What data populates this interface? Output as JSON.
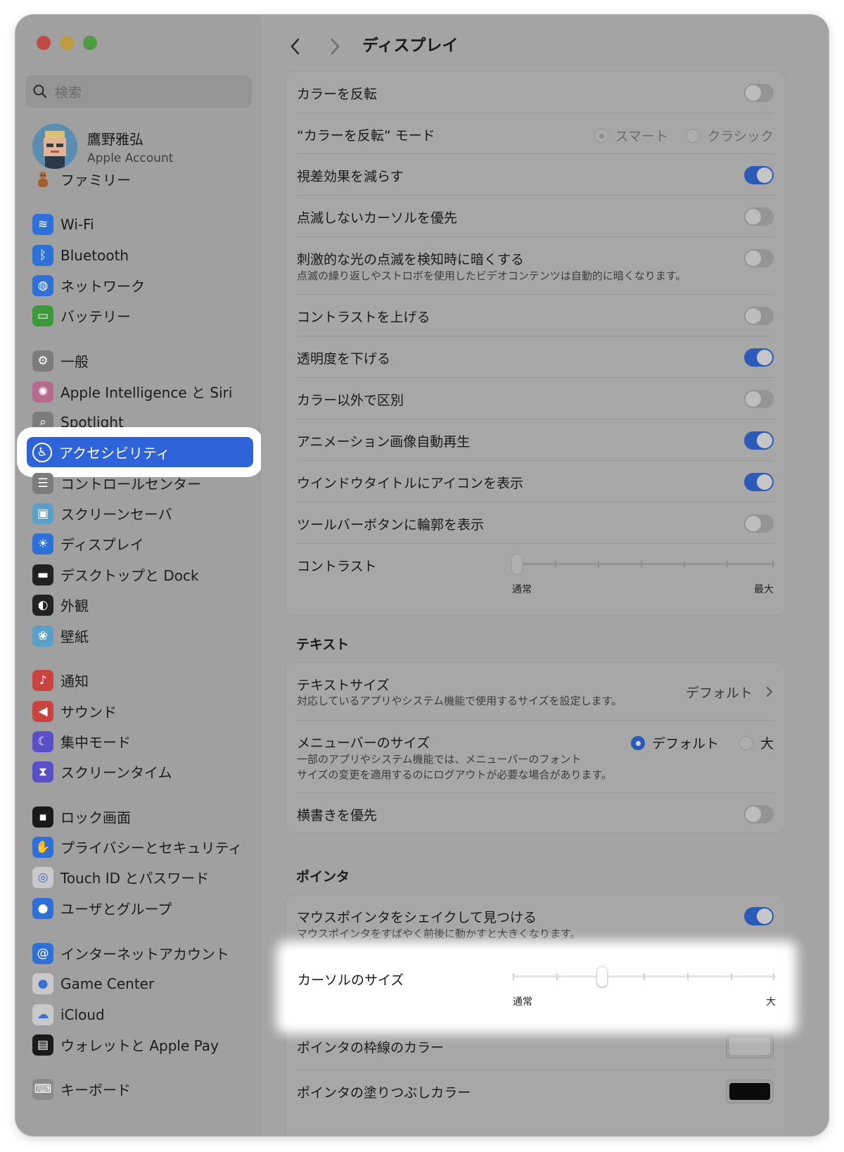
{
  "search": {
    "placeholder": "検索"
  },
  "account": {
    "name": "鷹野雅弘",
    "subtitle": "Apple Account"
  },
  "sidebar": {
    "family": "ファミリー",
    "items": [
      {
        "label": "Wi-Fi",
        "icon": "wifi-icon",
        "color": "#2f6fd8"
      },
      {
        "label": "Bluetooth",
        "icon": "bluetooth-icon",
        "color": "#2f6fd8"
      },
      {
        "label": "ネットワーク",
        "icon": "globe-icon",
        "color": "#2f6fd8"
      },
      {
        "label": "バッテリー",
        "icon": "battery-icon",
        "color": "#3c9a3a"
      },
      {
        "label": "一般",
        "icon": "gear-icon",
        "color": "#7c7c7c"
      },
      {
        "label": "Apple Intelligence と Siri",
        "icon": "siri-icon",
        "color": "#b56a8e"
      },
      {
        "label": "Spotlight",
        "icon": "spotlight-icon",
        "color": "#7c7c7c"
      },
      {
        "label": "アクセシビリティ",
        "icon": "accessibility-icon",
        "color": "#2f6fd8"
      },
      {
        "label": "コントロールセンター",
        "icon": "control-center-icon",
        "color": "#7c7c7c"
      },
      {
        "label": "スクリーンセーバ",
        "icon": "screensaver-icon",
        "color": "#5aa0c8"
      },
      {
        "label": "ディスプレイ",
        "icon": "display-icon",
        "color": "#2f6fd8"
      },
      {
        "label": "デスクトップと Dock",
        "icon": "dock-icon",
        "color": "#222222"
      },
      {
        "label": "外観",
        "icon": "appearance-icon",
        "color": "#222222"
      },
      {
        "label": "壁紙",
        "icon": "wallpaper-icon",
        "color": "#5aa0c8"
      },
      {
        "label": "通知",
        "icon": "bell-icon",
        "color": "#c9443f"
      },
      {
        "label": "サウンド",
        "icon": "speaker-icon",
        "color": "#c9443f"
      },
      {
        "label": "集中モード",
        "icon": "moon-icon",
        "color": "#5a4fc8"
      },
      {
        "label": "スクリーンタイム",
        "icon": "hourglass-icon",
        "color": "#5a4fc8"
      },
      {
        "label": "ロック画面",
        "icon": "lock-icon",
        "color": "#1a1a1a"
      },
      {
        "label": "プライバシーとセキュリティ",
        "icon": "hand-icon",
        "color": "#2f6fd8"
      },
      {
        "label": "Touch ID とパスワード",
        "icon": "fingerprint-icon",
        "color": "#c9c9c9"
      },
      {
        "label": "ユーザとグループ",
        "icon": "users-icon",
        "color": "#2f6fd8"
      },
      {
        "label": "インターネットアカウント",
        "icon": "at-icon",
        "color": "#2f6fd8"
      },
      {
        "label": "Game Center",
        "icon": "game-center-icon",
        "color": "#c9c9c9"
      },
      {
        "label": "iCloud",
        "icon": "cloud-icon",
        "color": "#c9c9c9"
      },
      {
        "label": "ウォレットと Apple Pay",
        "icon": "wallet-icon",
        "color": "#1a1a1a"
      },
      {
        "label": "キーボード",
        "icon": "keyboard-icon",
        "color": "#8a8a8a"
      }
    ],
    "selected": "アクセシビリティ"
  },
  "header": {
    "title": "ディスプレイ"
  },
  "display_settings": {
    "invert_colors": {
      "label": "カラーを反転",
      "on": false
    },
    "invert_mode": {
      "label": "“カラーを反転” モード",
      "options": [
        "スマート",
        "クラシック"
      ],
      "selected": "スマート"
    },
    "reduce_motion": {
      "label": "視差効果を減らす",
      "on": true
    },
    "non_blink_cursor": {
      "label": "点滅しないカーソルを優先",
      "on": false
    },
    "dim_flashing": {
      "label": "刺激的な光の点滅を検知時に暗くする",
      "desc": "点滅の繰り返しやストロボを使用したビデオコンテンツは自動的に暗くなります。",
      "on": false
    },
    "increase_contrast": {
      "label": "コントラストを上げる",
      "on": false
    },
    "reduce_transparency": {
      "label": "透明度を下げる",
      "on": true
    },
    "differentiate": {
      "label": "カラー以外で区別",
      "on": false
    },
    "animated_images": {
      "label": "アニメーション画像自動再生",
      "on": true
    },
    "window_title_icons": {
      "label": "ウインドウタイトルにアイコンを表示",
      "on": true
    },
    "toolbar_shapes": {
      "label": "ツールバーボタンに輪郭を表示",
      "on": false
    },
    "contrast": {
      "label": "コントラスト",
      "min_label": "通常",
      "max_label": "最大",
      "value": 0
    }
  },
  "text_section": {
    "heading": "テキスト",
    "text_size": {
      "label": "テキストサイズ",
      "desc": "対応しているアプリやシステム機能で使用するサイズを設定します。",
      "value": "デフォルト"
    },
    "menubar_size": {
      "label": "メニューバーのサイズ",
      "desc_line1": "一部のアプリやシステム機能では、メニューバーのフォント",
      "desc_line2": "サイズの変更を適用するのにログアウトが必要な場合があります。",
      "options": [
        "デフォルト",
        "大"
      ],
      "selected": "デフォルト"
    },
    "prefer_horizontal": {
      "label": "横書きを優先",
      "on": false
    }
  },
  "pointer_section": {
    "heading": "ポインタ",
    "shake_to_locate": {
      "label": "マウスポインタをシェイクして見つける",
      "desc": "マウスポインタをすばやく前後に動かすと大きくなります。",
      "on": true
    },
    "cursor_size": {
      "label": "カーソルのサイズ",
      "min_label": "通常",
      "max_label": "大",
      "value_fraction": 0.34
    },
    "outline_color": {
      "label": "ポインタの枠線のカラー",
      "color": "#b3b3b3"
    },
    "fill_color": {
      "label": "ポインタの塗りつぶしカラー",
      "color": "#0b0b0b"
    }
  }
}
